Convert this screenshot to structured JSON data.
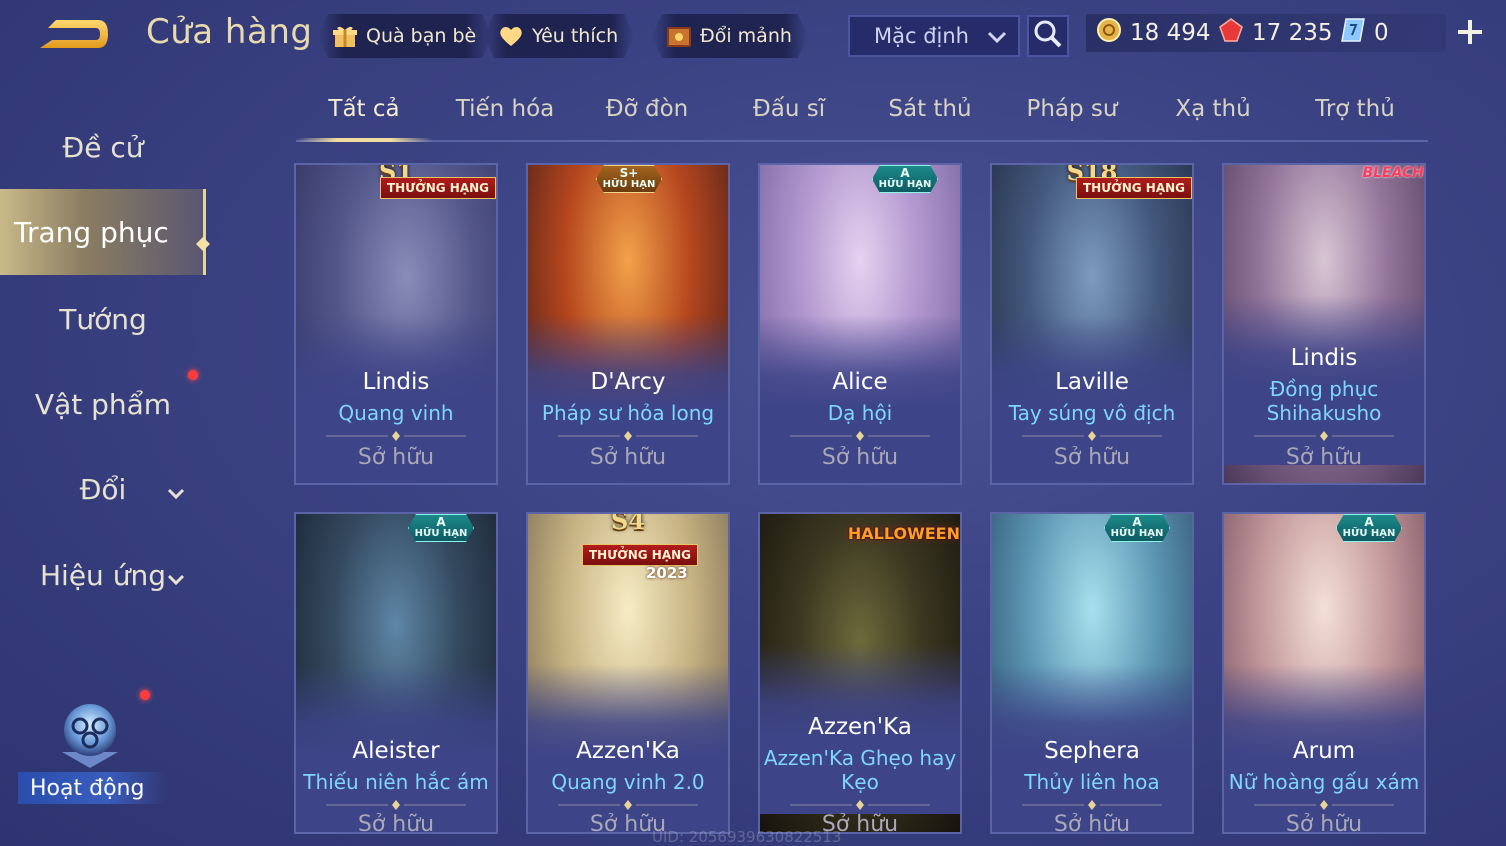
{
  "header": {
    "title": "Cửa hàng",
    "buttons": {
      "gift": "Quà bạn bè",
      "favorite": "Yêu thích",
      "exchange": "Đổi mảnh"
    },
    "sort": {
      "selected": "Mặc định"
    },
    "currencies": [
      {
        "icon": "gold-coin-icon",
        "value": "18 494"
      },
      {
        "icon": "ruby-gem-icon",
        "value": "17 235"
      },
      {
        "icon": "voucher-icon",
        "value": "0"
      }
    ]
  },
  "sidebar": {
    "items": [
      {
        "label": "Đề cử"
      },
      {
        "label": "Trang phục"
      },
      {
        "label": "Tướng"
      },
      {
        "label": "Vật phẩm"
      },
      {
        "label": "Đổi"
      },
      {
        "label": "Hiệu ứng"
      }
    ],
    "activity": "Hoạt động"
  },
  "tabs": [
    "Tất cả",
    "Tiến hóa",
    "Đỡ đòn",
    "Đấu sĩ",
    "Sát thủ",
    "Pháp sư",
    "Xạ thủ",
    "Trợ thủ"
  ],
  "cards": [
    {
      "hero": "Lindis",
      "skin": "Quang vinh",
      "status": "Sở hữu",
      "badge_top": "S1",
      "badge_rank": "THƯỞNG HẠNG",
      "colors": [
        "#6d6f9e",
        "#2b2d5c"
      ]
    },
    {
      "hero": "D'Arcy",
      "skin": "Pháp sư hỏa long",
      "status": "Sở hữu",
      "badge_limited": "S+ HỮU HẠN",
      "colors": [
        "#e0782a",
        "#6a2612"
      ]
    },
    {
      "hero": "Alice",
      "skin": "Dạ hội",
      "status": "Sở hữu",
      "badge_limited": "A HỮU HẠN",
      "colors": [
        "#c7b0d8",
        "#7d6aa2"
      ]
    },
    {
      "hero": "Laville",
      "skin": "Tay súng vô địch",
      "status": "Sở hữu",
      "badge_top": "S18",
      "badge_rank": "THƯỞNG HẠNG",
      "colors": [
        "#5e7ca0",
        "#26324f"
      ]
    },
    {
      "hero": "Lindis",
      "skin_lines": [
        "Đồng phục",
        "Shihakusho"
      ],
      "status": "Sở hữu",
      "badge_bleach": "BLEACH",
      "colors": [
        "#b5a0b8",
        "#5b4260"
      ]
    },
    {
      "hero": "Aleister",
      "skin": "Thiếu niên hắc ám",
      "status": "Sở hữu",
      "badge_limited": "A HỮU HẠN",
      "colors": [
        "#3f5f7c",
        "#1a2235"
      ]
    },
    {
      "hero": "Azzen'Ka",
      "skin": "Quang vinh 2.0",
      "status": "Sở hữu",
      "badge_top": "S4",
      "badge_rank": "THƯỞNG HẠNG",
      "badge_year": "2023",
      "colors": [
        "#e8d8a0",
        "#8a7a5a"
      ]
    },
    {
      "hero": "Azzen'Ka",
      "skin_lines": [
        "Azzen'Ka Ghẹo hay",
        "Kẹo"
      ],
      "status": "Sở hữu",
      "badge_halloween": "HALLOWEEN",
      "colors": [
        "#54502e",
        "#1f1c12"
      ]
    },
    {
      "hero": "Sephera",
      "skin": "Thủy liên hoa",
      "status": "Sở hữu",
      "badge_limited": "A HỮU HẠN",
      "colors": [
        "#6fb4c8",
        "#2e5470"
      ]
    },
    {
      "hero": "Arum",
      "skin": "Nữ hoàng gấu xám",
      "status": "Sở hữu",
      "badge_limited": "A HỮU HẠN",
      "colors": [
        "#e2c3c0",
        "#8a5a62"
      ]
    }
  ],
  "footer": {
    "uid": "UID: 2056939630822513"
  }
}
